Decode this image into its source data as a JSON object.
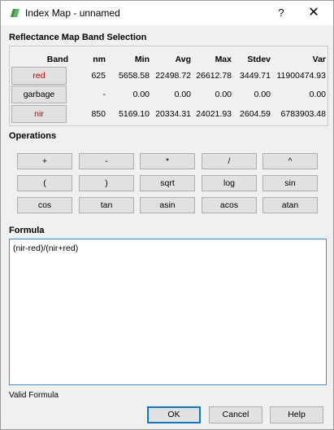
{
  "window": {
    "title": "Index Map - unnamed",
    "help_glyph": "?",
    "close_glyph": "✕"
  },
  "bands": {
    "section_title": "Reflectance Map Band Selection",
    "headers": [
      "Band",
      "nm",
      "Min",
      "Avg",
      "Max",
      "Stdev",
      "Var"
    ],
    "rows": [
      {
        "band": "red",
        "nm": "625",
        "min": "5658.58",
        "avg": "22498.72",
        "max": "26612.78",
        "stdev": "3449.71",
        "var": "11900474.93",
        "color": "#c00000"
      },
      {
        "band": "garbage",
        "nm": "-",
        "min": "0.00",
        "avg": "0.00",
        "max": "0.00",
        "stdev": "0.00",
        "var": "0.00",
        "color": "#000000"
      },
      {
        "band": "nir",
        "nm": "850",
        "min": "5169.10",
        "avg": "20334.31",
        "max": "24021.93",
        "stdev": "2604.59",
        "var": "6783903.48",
        "color": "#c00000"
      }
    ]
  },
  "operations": {
    "section_title": "Operations",
    "rows": [
      [
        "+",
        "-",
        "*",
        "/",
        "^"
      ],
      [
        "(",
        ")",
        "sqrt",
        "log",
        "sin"
      ],
      [
        "cos",
        "tan",
        "asin",
        "acos",
        "atan"
      ]
    ]
  },
  "formula": {
    "section_title": "Formula",
    "value": "(nir-red)/(nir+red)"
  },
  "status": "Valid Formula",
  "buttons": {
    "ok": "OK",
    "cancel": "Cancel",
    "help": "Help"
  }
}
